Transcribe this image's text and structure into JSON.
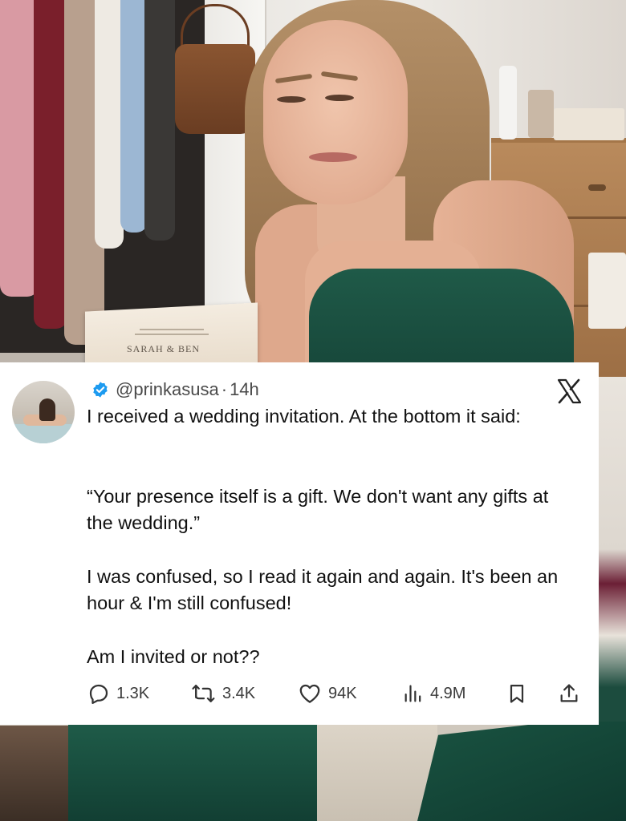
{
  "photo": {
    "invitation_text": "SARAH & BEN"
  },
  "tweet": {
    "handle": "@prinkasusa",
    "separator": "·",
    "time": "14h",
    "paragraphs": [
      "I received a wedding invitation. At the bottom it said:",
      "“Your presence itself is a gift. We don't want any gifts at the wedding.”",
      "I was confused, so I read it again and again. It's been an hour & I'm still confused!",
      "Am I invited or not??"
    ],
    "actions": {
      "replies": "1.3K",
      "reposts": "3.4K",
      "likes": "94K",
      "views": "4.9M"
    },
    "icons": {
      "verified": "verified-badge-icon",
      "platform": "x-logo-icon",
      "reply": "reply-icon",
      "repost": "repost-icon",
      "like": "heart-icon",
      "views": "views-icon",
      "bookmark": "bookmark-icon",
      "share": "share-icon"
    },
    "colors": {
      "verified": "#1d9bf0",
      "text": "#111111",
      "meta": "#4a4a4a"
    }
  }
}
